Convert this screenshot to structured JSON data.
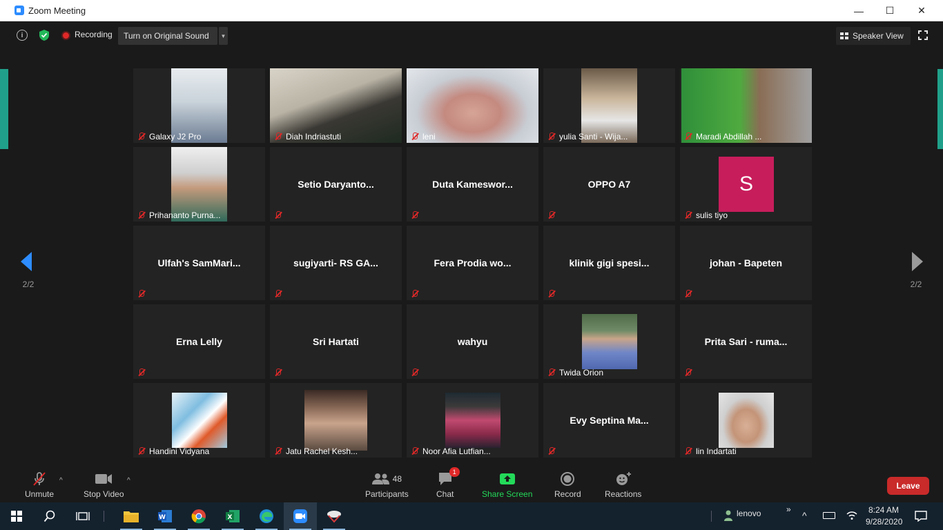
{
  "window": {
    "title": "Zoom Meeting",
    "minimize": "—",
    "maximize": "☐",
    "close": "✕"
  },
  "topbar": {
    "info": "i",
    "recording_label": "Recording",
    "original_sound_label": "Turn on Original Sound",
    "speaker_view_label": "Speaker View"
  },
  "pager": {
    "left": "2/2",
    "right": "2/2"
  },
  "participants": [
    {
      "name": "Galaxy J2 Pro",
      "video": true
    },
    {
      "name": "Diah Indriastuti",
      "video": true
    },
    {
      "name": "leni",
      "video": true
    },
    {
      "name": "yulia Santi - Wija...",
      "video": true
    },
    {
      "name": "Maradi Abdillah ...",
      "video": true
    },
    {
      "name": "Prihananto Purna...",
      "video": true
    },
    {
      "name": "Setio  Daryanto...",
      "video": false
    },
    {
      "name": "Duta  Kameswor...",
      "video": false
    },
    {
      "name": "OPPO A7",
      "video": false
    },
    {
      "name": "sulis tiyo",
      "video": false,
      "avatar_letter": "S"
    },
    {
      "name": "Ulfah's  SamMari...",
      "video": false
    },
    {
      "name": "sugiyarti-  RS GA...",
      "video": false
    },
    {
      "name": "Fera  Prodia  wo...",
      "video": false
    },
    {
      "name": "klinik  gigi  spesi...",
      "video": false
    },
    {
      "name": "johan - Bapeten",
      "video": false
    },
    {
      "name": "Erna Lelly",
      "video": false
    },
    {
      "name": "Sri Hartati",
      "video": false
    },
    {
      "name": "wahyu",
      "video": false
    },
    {
      "name": "Twida Orion",
      "video": false,
      "photo": true
    },
    {
      "name": "Prita Sari - ruma...",
      "video": false
    },
    {
      "name": "Handini Vidyana",
      "video": false,
      "photo": true
    },
    {
      "name": "Jatu Rachel Kesh...",
      "video": false,
      "photo": true
    },
    {
      "name": "Noor Afia Lutfian...",
      "video": false,
      "photo": true
    },
    {
      "name": "Evy  Septina  Ma...",
      "video": false
    },
    {
      "name": "lin Indartati",
      "video": false,
      "photo": true
    }
  ],
  "toolbar": {
    "unmute": "Unmute",
    "stop_video": "Stop Video",
    "participants": "Participants",
    "participants_count": "48",
    "chat": "Chat",
    "chat_badge": "1",
    "share_screen": "Share Screen",
    "record": "Record",
    "reactions": "Reactions",
    "leave": "Leave"
  },
  "taskbar": {
    "user": "lenovo",
    "time": "8:24 AM",
    "date": "9/28/2020",
    "overflow": "»"
  },
  "colors": {
    "accent": "#2d8cff",
    "leave": "#c92a2a",
    "share": "#23d959",
    "mute": "#e02828",
    "avatar": "#c71d5b"
  }
}
